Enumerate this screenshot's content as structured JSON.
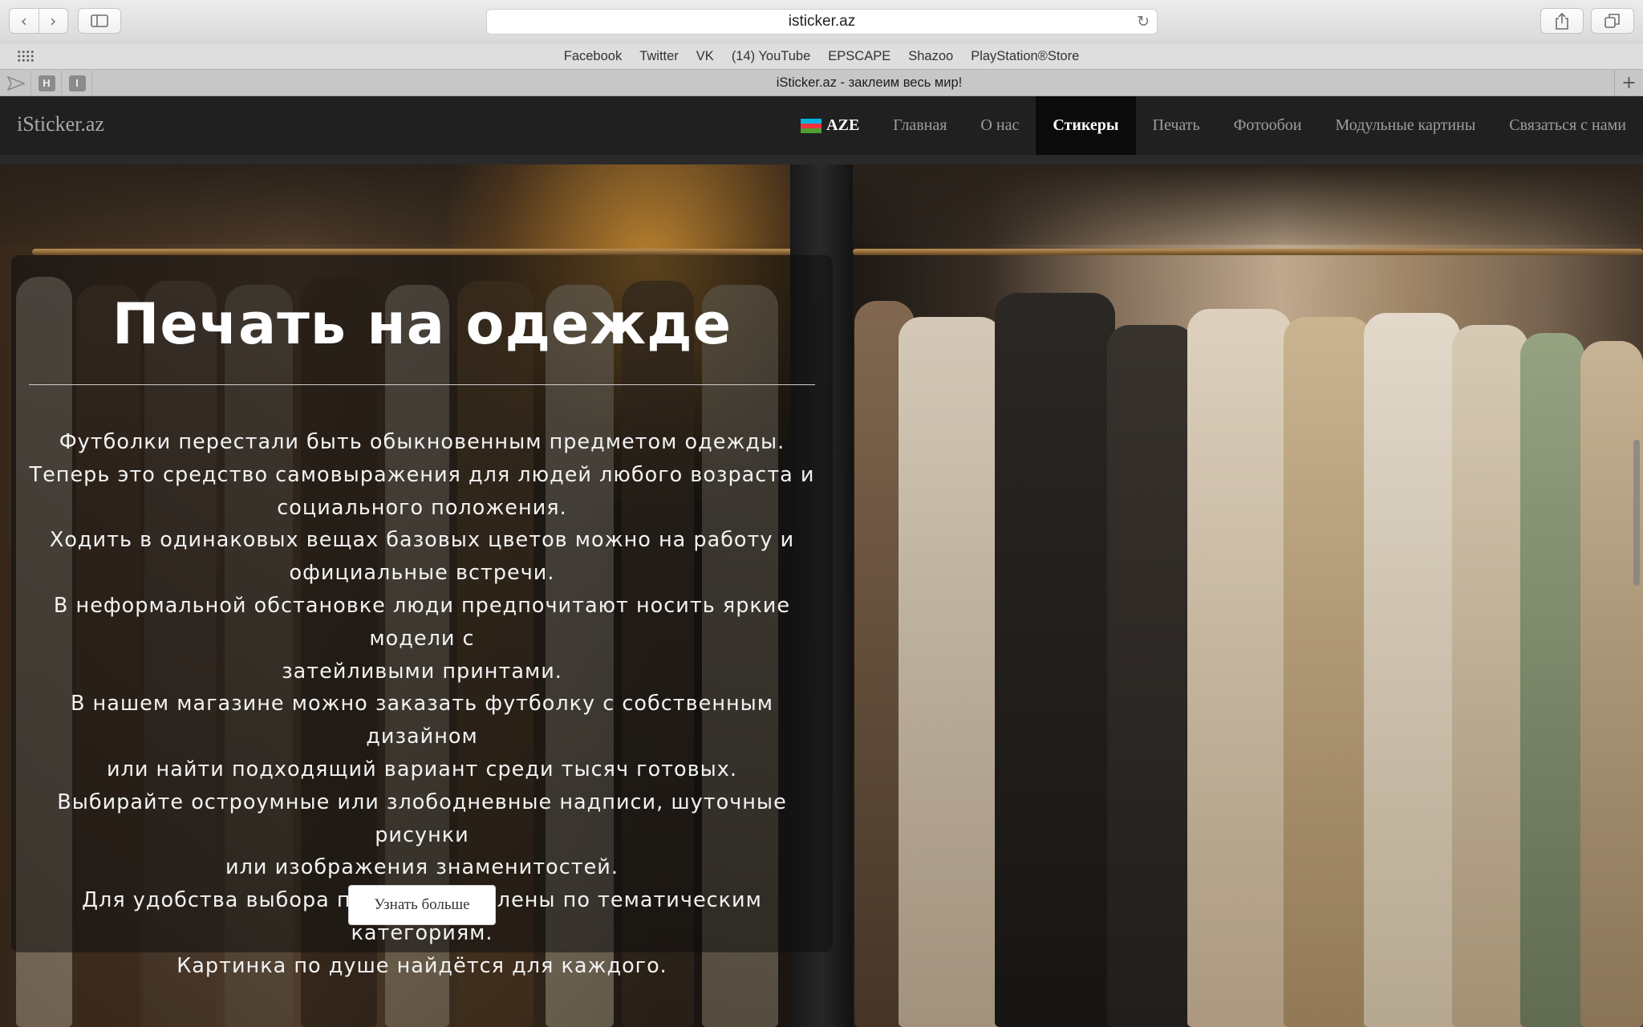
{
  "browser": {
    "url": "isticker.az",
    "tab_title": "iSticker.az - заклеим весь мир!",
    "bookmarks": [
      "Facebook",
      "Twitter",
      "VK",
      "(14) YouTube",
      "EPSCAPE",
      "Shazoo",
      "PlayStation®Store"
    ],
    "pinned_tabs": [
      "H",
      "I"
    ]
  },
  "site": {
    "brand": "iSticker.az",
    "lang": "AZE",
    "nav": [
      "Главная",
      "О нас",
      "Стикеры",
      "Печать",
      "Фотообои",
      "Модульные картины",
      "Связаться с нами"
    ],
    "active_nav": "Стикеры"
  },
  "hero": {
    "title": "Печать на одежде",
    "lines": [
      "Футболки перестали быть обыкновенным предметом одежды.",
      "Теперь это средство самовыражения для людей любого возраста и",
      "социального положения.",
      "Ходить в одинаковых вещах базовых цветов можно на работу и",
      "официальные встречи.",
      "В неформальной обстановке люди предпочитают носить яркие модели с",
      "затейливыми принтами.",
      "В нашем магазине можно заказать футболку с собственным дизайном",
      "или найти подходящий вариант среди тысяч готовых.",
      "Выбирайте остроумные или злободневные надписи, шуточные рисунки",
      "или изображения знаменитостей.",
      "Для удобства выбора принты разделены по тематическим категориям.",
      "Картинка по душе найдётся для каждого."
    ],
    "button": "Узнать больше"
  },
  "colors": {
    "nav_bg": "#202020",
    "nav_active_bg": "#0b0b0b",
    "flag": [
      "#00b5e2",
      "#ef3340",
      "#509e2f"
    ]
  }
}
